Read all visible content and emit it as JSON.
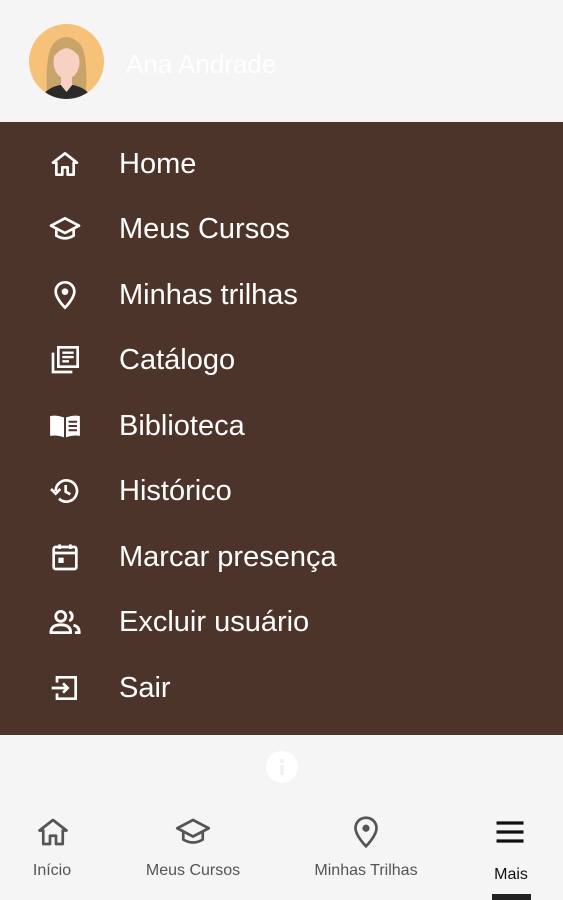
{
  "user": {
    "name": "Ana Andrade"
  },
  "menu": {
    "items": [
      {
        "label": "Home",
        "icon": "home-icon"
      },
      {
        "label": "Meus Cursos",
        "icon": "graduation-cap-icon"
      },
      {
        "label": "Minhas trilhas",
        "icon": "location-pin-icon"
      },
      {
        "label": "Catálogo",
        "icon": "catalog-icon"
      },
      {
        "label": "Biblioteca",
        "icon": "open-book-icon"
      },
      {
        "label": "Histórico",
        "icon": "history-icon"
      },
      {
        "label": "Marcar presença",
        "icon": "calendar-icon"
      },
      {
        "label": "Excluir usuário",
        "icon": "users-icon"
      },
      {
        "label": "Sair",
        "icon": "logout-icon"
      }
    ]
  },
  "bottom_nav": {
    "items": [
      {
        "label": "Início",
        "icon": "home-icon"
      },
      {
        "label": "Meus Cursos",
        "icon": "graduation-cap-icon"
      },
      {
        "label": "Minhas Trilhas",
        "icon": "location-pin-icon"
      },
      {
        "label": "Mais",
        "icon": "menu-icon",
        "active": true
      }
    ]
  },
  "colors": {
    "menu_background": "#4d342b",
    "menu_text": "#ffffff",
    "page_background": "#f5f5f5",
    "avatar_background": "#f6c27a"
  }
}
